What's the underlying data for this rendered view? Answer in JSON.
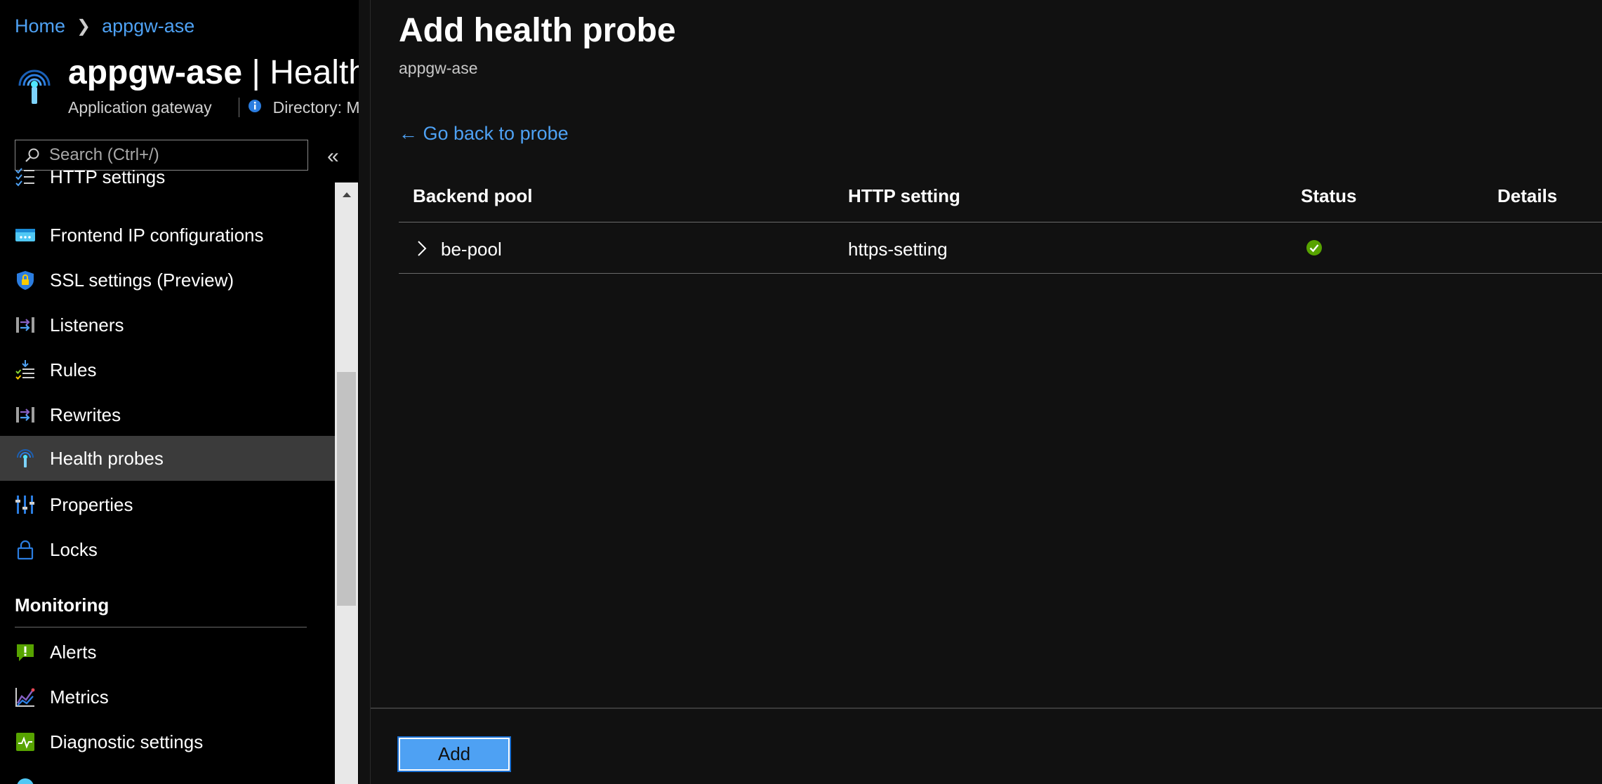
{
  "breadcrumb": {
    "home": "Home",
    "resource": "appgw-ase"
  },
  "resource": {
    "name": "appgw-ase",
    "separator": "|",
    "page": "Health",
    "type": "Application gateway",
    "directory": "Directory: M"
  },
  "search": {
    "placeholder": "Search (Ctrl+/)"
  },
  "sidebar": {
    "items": [
      {
        "label": "HTTP settings",
        "icon": "list-check-icon"
      },
      {
        "label": "Frontend IP configurations",
        "icon": "ip-config-icon"
      },
      {
        "label": "SSL settings (Preview)",
        "icon": "shield-lock-icon"
      },
      {
        "label": "Listeners",
        "icon": "listener-icon"
      },
      {
        "label": "Rules",
        "icon": "rules-icon"
      },
      {
        "label": "Rewrites",
        "icon": "rewrite-icon"
      },
      {
        "label": "Health probes",
        "icon": "health-probe-icon",
        "active": true
      },
      {
        "label": "Properties",
        "icon": "properties-icon"
      },
      {
        "label": "Locks",
        "icon": "lock-icon"
      }
    ],
    "monitoring": {
      "heading": "Monitoring",
      "items": [
        {
          "label": "Alerts",
          "icon": "alert-icon"
        },
        {
          "label": "Metrics",
          "icon": "metrics-icon"
        },
        {
          "label": "Diagnostic settings",
          "icon": "diagnostic-icon"
        }
      ]
    }
  },
  "panel": {
    "title": "Add health probe",
    "subtitle": "appgw-ase",
    "back_link": "← Go back to probe",
    "table": {
      "headers": [
        "Backend pool",
        "HTTP setting",
        "Status",
        "Details"
      ],
      "rows": [
        {
          "backend_pool": "be-pool",
          "http_setting": "https-setting",
          "status": "healthy",
          "details": ""
        }
      ]
    },
    "add_label": "Add"
  },
  "colors": {
    "accent": "#4ea1f3",
    "background": "#111111",
    "sidebar_bg": "#000000",
    "active_item": "#3b3b3b",
    "status_ok": "#57a300"
  }
}
